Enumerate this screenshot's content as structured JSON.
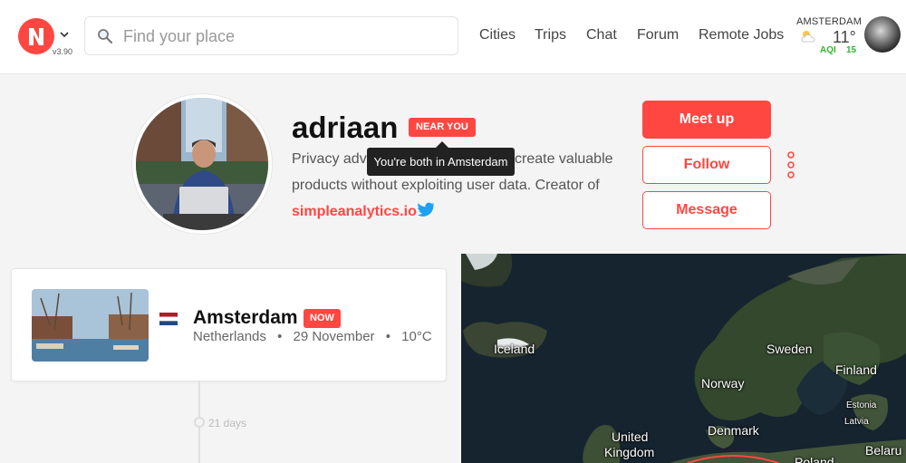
{
  "header": {
    "version": "v3.90",
    "search": {
      "placeholder": "Find your place",
      "value": ""
    },
    "nav": [
      "Cities",
      "Trips",
      "Chat",
      "Forum",
      "Remote Jobs"
    ],
    "weather": {
      "city": "AMSTERDAM",
      "temp": "11°",
      "aqi_label": "AQI",
      "aqi_value": "15",
      "icon": "partly-cloudy-icon"
    }
  },
  "profile": {
    "username": "adriaan",
    "badge": "NEAR YOU",
    "tooltip": "You're both in Amsterdam",
    "bio_line1_start": "Privacy adv",
    "bio_line1_end": "create valuable",
    "bio_line2": "products without exploiting user data. Creator of",
    "link": "simpleanalytics.io",
    "actions": {
      "meet_up": "Meet up",
      "follow": "Follow",
      "message": "Message"
    }
  },
  "trip": {
    "city": "Amsterdam",
    "badge": "NOW",
    "country": "Netherlands",
    "date": "29 November",
    "temperature": "10°C",
    "flag": "netherlands-flag"
  },
  "timeline": {
    "gap_label": "21 days"
  },
  "map": {
    "labels": [
      "Iceland",
      "Sweden",
      "Finland",
      "Norway",
      "Estonia",
      "Latvia",
      "Denmark",
      "United",
      "Kingdom",
      "Belaru",
      "Poland"
    ]
  },
  "colors": {
    "accent": "#ff4742",
    "aqi_good": "#2eb82e",
    "map_sea": "#16242f"
  }
}
